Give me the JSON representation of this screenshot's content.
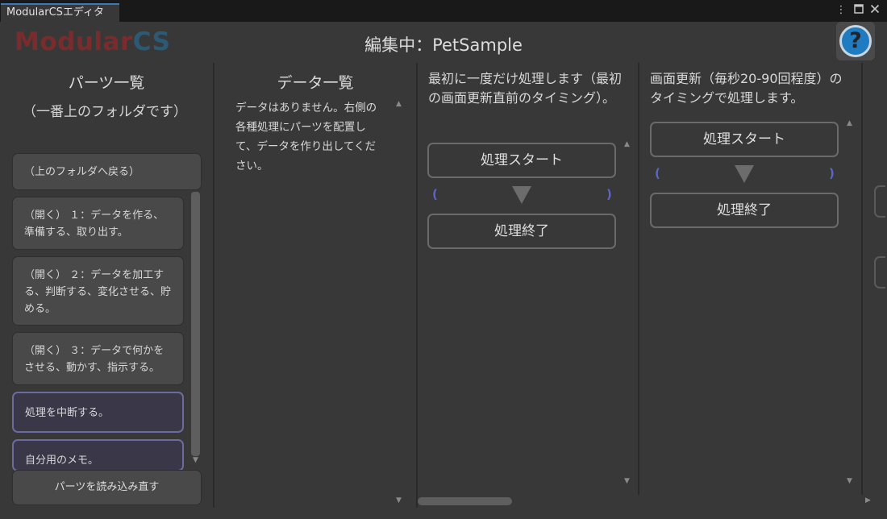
{
  "window": {
    "tab_label": "ModularCSエディタ",
    "menu_icon": "more-icon",
    "maximize_icon": "maximize-icon",
    "close_icon": "close-icon"
  },
  "header": {
    "logo_part1": "Modular",
    "logo_part2": "CS",
    "title": "編集中：PetSample",
    "help_icon": "help-icon",
    "help_label": "?"
  },
  "parts_panel": {
    "title": "パーツ一覧",
    "subtitle": "（一番上のフォルダです）",
    "items": [
      {
        "label": "（上のフォルダへ戻る）"
      },
      {
        "label": "（開く） １：データを作る、準備する、取り出す。"
      },
      {
        "label": "（開く） ２：データを加工する、判断する、変化させる、貯める。"
      },
      {
        "label": "（開く） ３：データで何かをさせる、動かす、指示する。"
      },
      {
        "label": "処理を中断する。"
      },
      {
        "label": "自分用のメモ。"
      }
    ],
    "reload_label": "パーツを読み込み直す"
  },
  "data_panel": {
    "title": "データ一覧",
    "empty_message": "データはありません。右側の各種処理にパーツを配置して、データを作り出してください。"
  },
  "process_columns": [
    {
      "description": "最初に一度だけ処理します（最初の画面更新直前のタイミング）。",
      "start_label": "処理スタート",
      "end_label": "処理終了",
      "paren_open": "(",
      "paren_close": ")"
    },
    {
      "description": "画面更新（毎秒20-90回程度）のタイミングで処理します。",
      "start_label": "処理スタート",
      "end_label": "処理終了",
      "paren_open": "(",
      "paren_close": ")"
    }
  ],
  "colors": {
    "accent_blue": "#3a79bb",
    "logo_red": "#7a2c2c",
    "logo_blue": "#2c5a75",
    "paren_blue": "#5b66c8",
    "selected_border": "#6b6b9e"
  }
}
